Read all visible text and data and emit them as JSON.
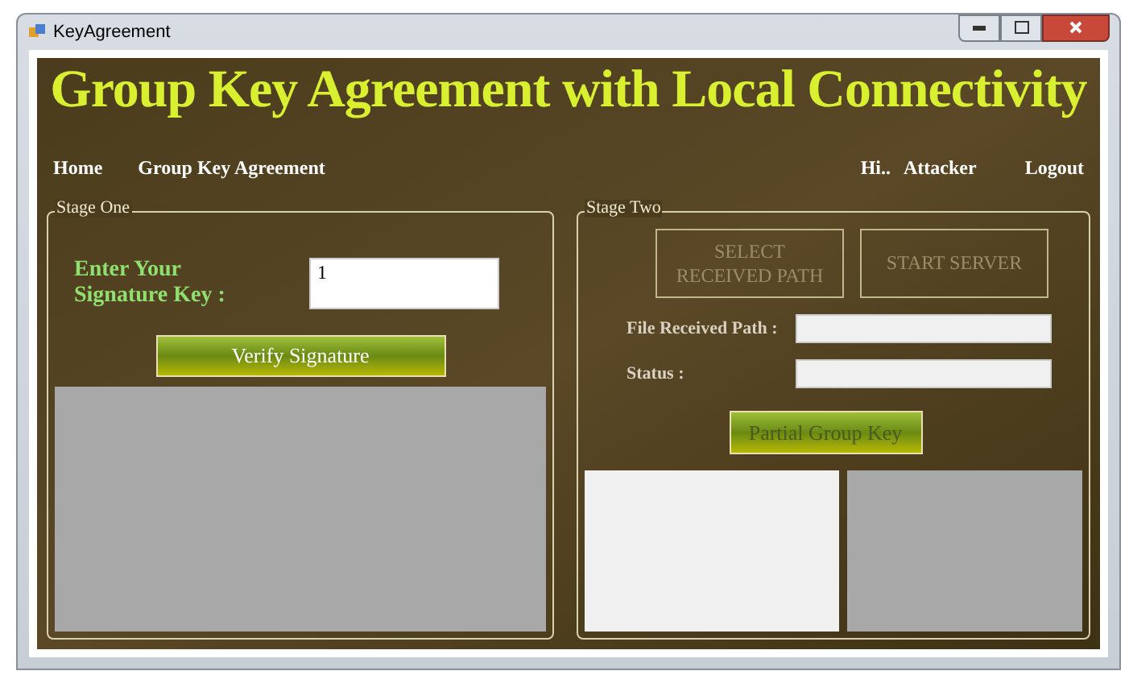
{
  "window": {
    "title": "KeyAgreement"
  },
  "header": {
    "title": "Group Key Agreement with Local Connectivity"
  },
  "nav": {
    "left": [
      {
        "label": "Home"
      },
      {
        "label": "Group Key Agreement"
      }
    ],
    "greeting": "Hi..",
    "user": "Attacker",
    "logout": "Logout"
  },
  "stage_one": {
    "title": "Stage One",
    "label": "Enter Your Signature Key :",
    "value": "1",
    "button": {
      "label": "Verify Signature",
      "disabled": false
    }
  },
  "stage_two": {
    "title": "Stage Two",
    "buttons": [
      {
        "label": "SELECT RECEIVED PATH",
        "disabled": true
      },
      {
        "label": "START SERVER",
        "disabled": true
      }
    ],
    "fields": [
      {
        "label": "File Received Path :"
      },
      {
        "label": "Status :"
      }
    ],
    "button": {
      "label": "Partial Group Key",
      "disabled": true
    }
  }
}
